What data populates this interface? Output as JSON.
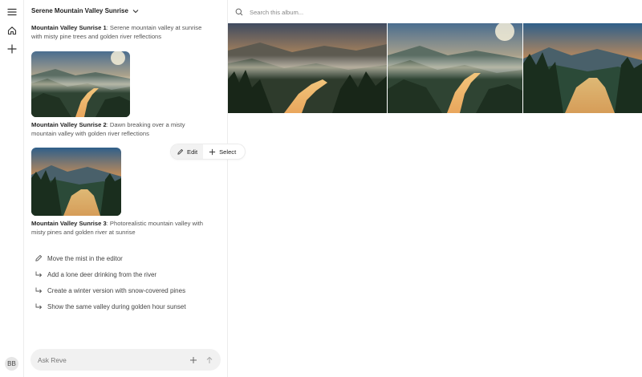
{
  "user": {
    "initials": "BB"
  },
  "album": {
    "title": "Serene Mountain Valley Sunrise"
  },
  "items": [
    {
      "name": "Mountain Valley Sunrise 1",
      "desc": ": Serene mountain valley at sunrise with misty pine trees and golden river reflections"
    },
    {
      "name": "Mountain Valley Sunrise 2",
      "desc": ": Dawn breaking over a misty mountain valley with golden river reflections"
    },
    {
      "name": "Mountain Valley Sunrise 3",
      "desc": ": Photorealistic mountain valley with misty pines and golden river at sunrise"
    }
  ],
  "actions": {
    "edit": "Edit",
    "select": "Select"
  },
  "suggestions": [
    {
      "label": "Move the mist in the editor",
      "icon": "pencil-icon"
    },
    {
      "label": "Add a lone deer drinking from the river",
      "icon": "arrow-return-icon"
    },
    {
      "label": "Create a winter version with snow-covered pines",
      "icon": "arrow-return-icon"
    },
    {
      "label": "Show the same valley during golden hour sunset",
      "icon": "arrow-return-icon"
    }
  ],
  "chat": {
    "placeholder": "Ask Reve"
  },
  "search": {
    "placeholder": "Search this album..."
  }
}
